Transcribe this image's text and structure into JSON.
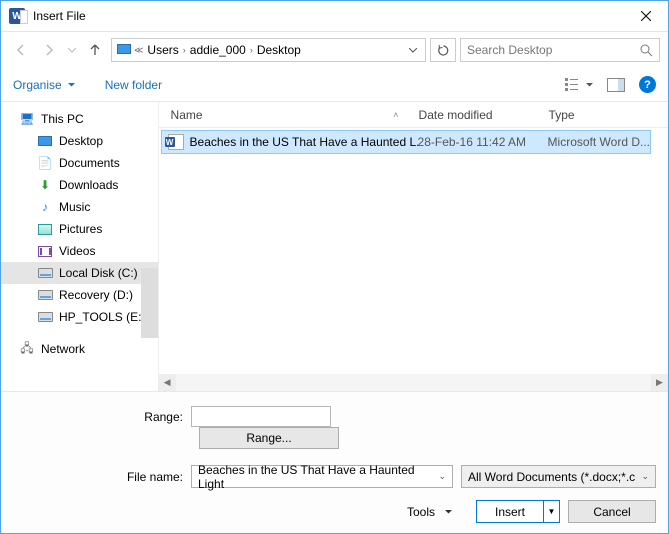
{
  "title": "Insert File",
  "breadcrumb": {
    "seg1": "Users",
    "seg2": "addie_000",
    "seg3": "Desktop"
  },
  "search": {
    "placeholder": "Search Desktop"
  },
  "toolbar": {
    "organise": "Organise",
    "newfolder": "New folder"
  },
  "sidebar": {
    "thispc": "This PC",
    "desktop": "Desktop",
    "documents": "Documents",
    "downloads": "Downloads",
    "music": "Music",
    "pictures": "Pictures",
    "videos": "Videos",
    "localdisk": "Local Disk (C:)",
    "recovery": "Recovery (D:)",
    "hptools": "HP_TOOLS (E:)",
    "network": "Network"
  },
  "columns": {
    "name": "Name",
    "date": "Date modified",
    "type": "Type"
  },
  "files": [
    {
      "name": "Beaches in the US That Have a Haunted L...",
      "date": "28-Feb-16 11:42 AM",
      "type": "Microsoft Word D..."
    }
  ],
  "range": {
    "label": "Range:",
    "button": "Range..."
  },
  "filename": {
    "label": "File name:",
    "value": "Beaches in the US That Have a Haunted Light"
  },
  "filetype": "All Word Documents (*.docx;*.c",
  "tools_label": "Tools",
  "insert_label": "Insert",
  "cancel_label": "Cancel"
}
